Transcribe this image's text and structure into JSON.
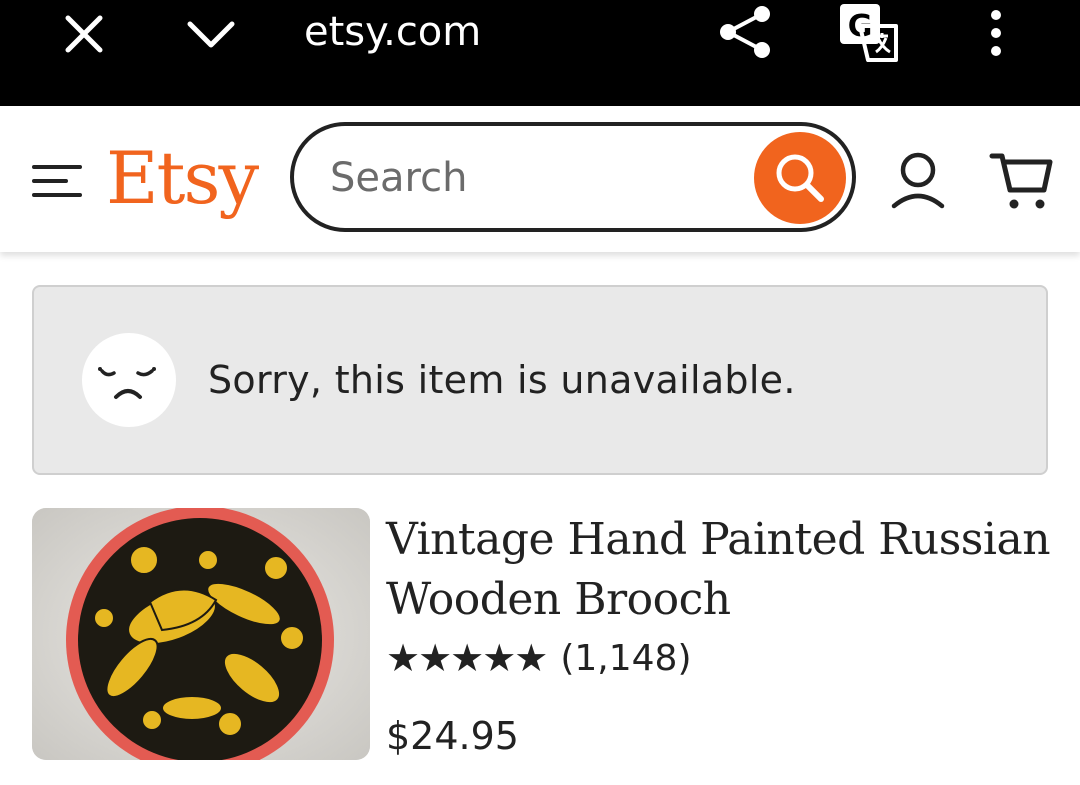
{
  "browser": {
    "url": "etsy.com",
    "icons": [
      "close-icon",
      "chevron-down-icon",
      "share-icon",
      "translate-icon",
      "more-vert-icon"
    ]
  },
  "header": {
    "logo": "Etsy",
    "search_placeholder": "Search",
    "colors": {
      "brand": "#f1641e"
    },
    "icons": [
      "menu-icon",
      "search-icon",
      "user-icon",
      "cart-icon"
    ]
  },
  "notice": {
    "message": "Sorry, this item is unavailable.",
    "icon": "sad-face-icon"
  },
  "listing": {
    "title": "Vintage Hand Painted Russian Wooden Brooch",
    "stars": "★★★★★",
    "rating_value": 5,
    "review_count": "(1,148)",
    "price": "$24.95"
  }
}
